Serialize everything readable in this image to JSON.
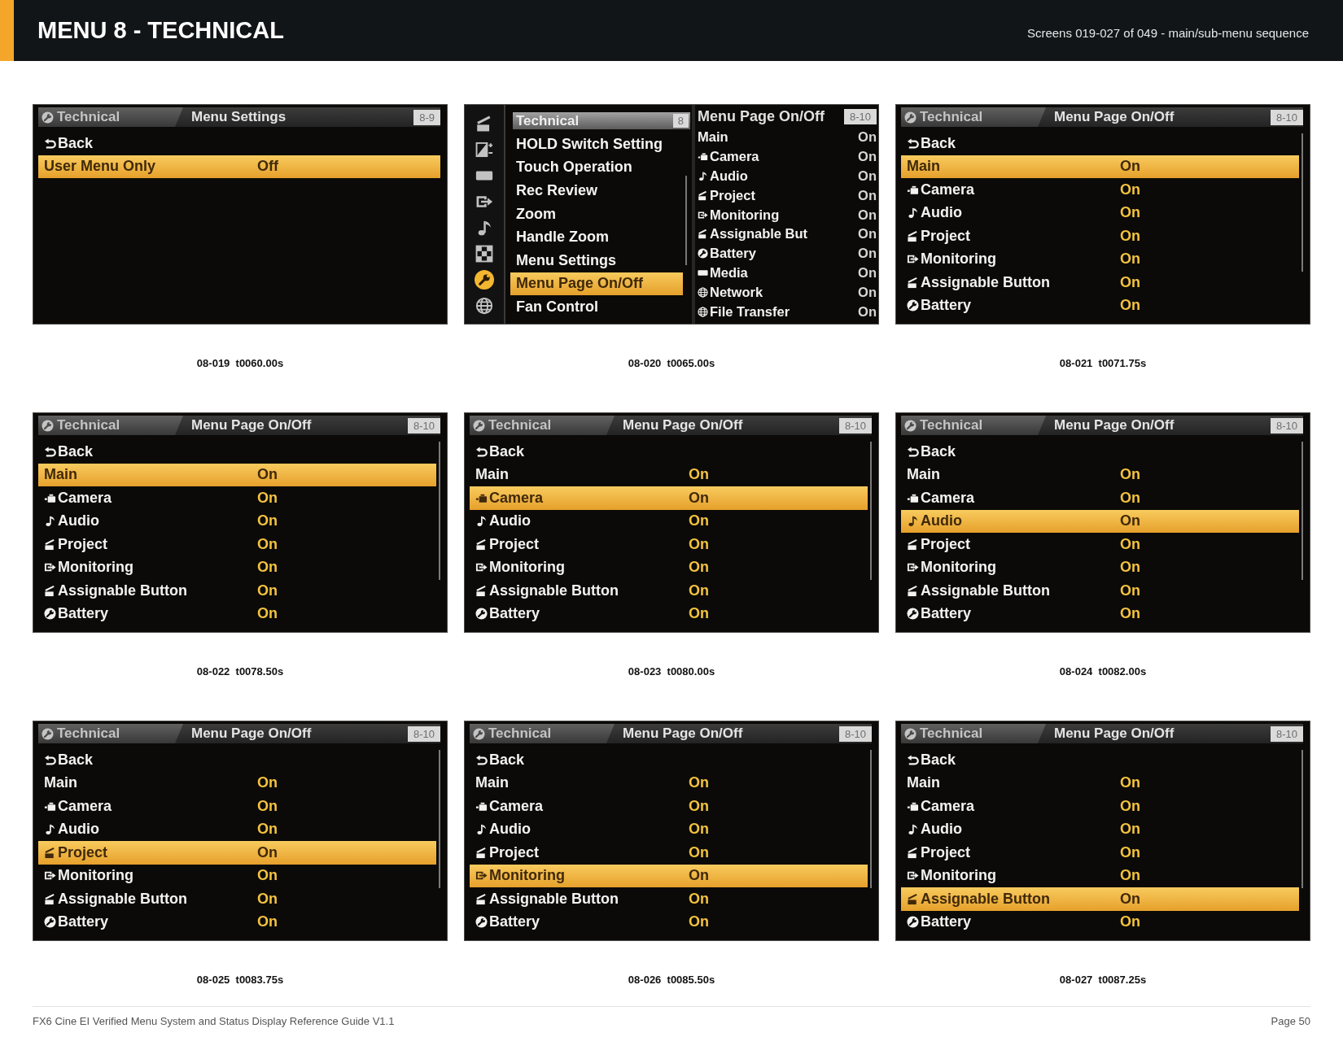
{
  "header": {
    "title": "MENU 8 - TECHNICAL",
    "subtitle": "Screens 019-027 of 049 - main/sub-menu sequence"
  },
  "screens": [
    {
      "kind": "list",
      "breadcrumb": "Technical",
      "title": "Menu Settings",
      "page": "8-9",
      "back": "Back",
      "scrollable": false,
      "rows": [
        {
          "kind": "plain",
          "label": "User Menu Only",
          "value": "Off",
          "selected": true
        }
      ],
      "caption": "08-019  t0060.00s"
    },
    {
      "kind": "split",
      "categories": [
        {
          "kind": "project",
          "selected": false
        },
        {
          "kind": "paint",
          "selected": false
        },
        {
          "kind": "media",
          "selected": false
        },
        {
          "kind": "monitoring",
          "selected": false
        },
        {
          "kind": "audio",
          "selected": false
        },
        {
          "kind": "grid",
          "selected": false
        },
        {
          "kind": "technical",
          "selected": true
        },
        {
          "kind": "network",
          "selected": false
        }
      ],
      "menu": {
        "title": "Technical",
        "page": "8",
        "scrollable": true,
        "items": [
          {
            "label": "HOLD Switch Setting",
            "selected": false
          },
          {
            "label": "Touch Operation",
            "selected": false
          },
          {
            "label": "Rec Review",
            "selected": false
          },
          {
            "label": "Zoom",
            "selected": false
          },
          {
            "label": "Handle Zoom",
            "selected": false
          },
          {
            "label": "Menu Settings",
            "selected": false
          },
          {
            "label": "Menu Page On/Off",
            "selected": true
          },
          {
            "label": "Fan Control",
            "selected": false
          }
        ]
      },
      "submenu": {
        "title": "Menu Page On/Off",
        "page": "8-10",
        "rows": [
          {
            "kind": "plain",
            "label": "Main",
            "value": "On"
          },
          {
            "kind": "camera",
            "label": "Camera",
            "value": "On"
          },
          {
            "kind": "audio",
            "label": "Audio",
            "value": "On"
          },
          {
            "kind": "project",
            "label": "Project",
            "value": "On"
          },
          {
            "kind": "monitoring",
            "label": "Monitoring",
            "value": "On"
          },
          {
            "kind": "assignable",
            "label": "Assignable But",
            "value": "On"
          },
          {
            "kind": "battery",
            "label": "Battery",
            "value": "On"
          },
          {
            "kind": "media",
            "label": "Media",
            "value": "On"
          },
          {
            "kind": "network",
            "label": "Network",
            "value": "On"
          },
          {
            "kind": "transfer",
            "label": "File Transfer",
            "value": "On"
          }
        ]
      },
      "caption": "08-020  t0065.00s"
    },
    {
      "kind": "list",
      "breadcrumb": "Technical",
      "title": "Menu Page On/Off",
      "page": "8-10",
      "back": "Back",
      "scrollable": true,
      "rows": [
        {
          "kind": "plain",
          "label": "Main",
          "value": "On",
          "selected": true
        },
        {
          "kind": "camera",
          "label": "Camera",
          "value": "On",
          "selected": false
        },
        {
          "kind": "audio",
          "label": "Audio",
          "value": "On",
          "selected": false
        },
        {
          "kind": "project",
          "label": "Project",
          "value": "On",
          "selected": false
        },
        {
          "kind": "monitoring",
          "label": "Monitoring",
          "value": "On",
          "selected": false
        },
        {
          "kind": "assignable",
          "label": "Assignable Button",
          "value": "On",
          "selected": false
        },
        {
          "kind": "battery",
          "label": "Battery",
          "value": "On",
          "selected": false
        }
      ],
      "caption": "08-021  t0071.75s"
    },
    {
      "kind": "list",
      "breadcrumb": "Technical",
      "title": "Menu Page On/Off",
      "page": "8-10",
      "back": "Back",
      "scrollable": true,
      "rows": [
        {
          "kind": "plain",
          "label": "Main",
          "value": "On",
          "selected": true
        },
        {
          "kind": "camera",
          "label": "Camera",
          "value": "On",
          "selected": false
        },
        {
          "kind": "audio",
          "label": "Audio",
          "value": "On",
          "selected": false
        },
        {
          "kind": "project",
          "label": "Project",
          "value": "On",
          "selected": false
        },
        {
          "kind": "monitoring",
          "label": "Monitoring",
          "value": "On",
          "selected": false
        },
        {
          "kind": "assignable",
          "label": "Assignable Button",
          "value": "On",
          "selected": false
        },
        {
          "kind": "battery",
          "label": "Battery",
          "value": "On",
          "selected": false
        }
      ],
      "caption": "08-022  t0078.50s"
    },
    {
      "kind": "list",
      "breadcrumb": "Technical",
      "title": "Menu Page On/Off",
      "page": "8-10",
      "back": "Back",
      "scrollable": true,
      "rows": [
        {
          "kind": "plain",
          "label": "Main",
          "value": "On",
          "selected": false
        },
        {
          "kind": "camera",
          "label": "Camera",
          "value": "On",
          "selected": true
        },
        {
          "kind": "audio",
          "label": "Audio",
          "value": "On",
          "selected": false
        },
        {
          "kind": "project",
          "label": "Project",
          "value": "On",
          "selected": false
        },
        {
          "kind": "monitoring",
          "label": "Monitoring",
          "value": "On",
          "selected": false
        },
        {
          "kind": "assignable",
          "label": "Assignable Button",
          "value": "On",
          "selected": false
        },
        {
          "kind": "battery",
          "label": "Battery",
          "value": "On",
          "selected": false
        }
      ],
      "caption": "08-023  t0080.00s"
    },
    {
      "kind": "list",
      "breadcrumb": "Technical",
      "title": "Menu Page On/Off",
      "page": "8-10",
      "back": "Back",
      "scrollable": true,
      "rows": [
        {
          "kind": "plain",
          "label": "Main",
          "value": "On",
          "selected": false
        },
        {
          "kind": "camera",
          "label": "Camera",
          "value": "On",
          "selected": false
        },
        {
          "kind": "audio",
          "label": "Audio",
          "value": "On",
          "selected": true
        },
        {
          "kind": "project",
          "label": "Project",
          "value": "On",
          "selected": false
        },
        {
          "kind": "monitoring",
          "label": "Monitoring",
          "value": "On",
          "selected": false
        },
        {
          "kind": "assignable",
          "label": "Assignable Button",
          "value": "On",
          "selected": false
        },
        {
          "kind": "battery",
          "label": "Battery",
          "value": "On",
          "selected": false
        }
      ],
      "caption": "08-024  t0082.00s"
    },
    {
      "kind": "list",
      "breadcrumb": "Technical",
      "title": "Menu Page On/Off",
      "page": "8-10",
      "back": "Back",
      "scrollable": true,
      "rows": [
        {
          "kind": "plain",
          "label": "Main",
          "value": "On",
          "selected": false
        },
        {
          "kind": "camera",
          "label": "Camera",
          "value": "On",
          "selected": false
        },
        {
          "kind": "audio",
          "label": "Audio",
          "value": "On",
          "selected": false
        },
        {
          "kind": "project",
          "label": "Project",
          "value": "On",
          "selected": true
        },
        {
          "kind": "monitoring",
          "label": "Monitoring",
          "value": "On",
          "selected": false
        },
        {
          "kind": "assignable",
          "label": "Assignable Button",
          "value": "On",
          "selected": false
        },
        {
          "kind": "battery",
          "label": "Battery",
          "value": "On",
          "selected": false
        }
      ],
      "caption": "08-025  t0083.75s"
    },
    {
      "kind": "list",
      "breadcrumb": "Technical",
      "title": "Menu Page On/Off",
      "page": "8-10",
      "back": "Back",
      "scrollable": true,
      "rows": [
        {
          "kind": "plain",
          "label": "Main",
          "value": "On",
          "selected": false
        },
        {
          "kind": "camera",
          "label": "Camera",
          "value": "On",
          "selected": false
        },
        {
          "kind": "audio",
          "label": "Audio",
          "value": "On",
          "selected": false
        },
        {
          "kind": "project",
          "label": "Project",
          "value": "On",
          "selected": false
        },
        {
          "kind": "monitoring",
          "label": "Monitoring",
          "value": "On",
          "selected": true
        },
        {
          "kind": "assignable",
          "label": "Assignable Button",
          "value": "On",
          "selected": false
        },
        {
          "kind": "battery",
          "label": "Battery",
          "value": "On",
          "selected": false
        }
      ],
      "caption": "08-026  t0085.50s"
    },
    {
      "kind": "list",
      "breadcrumb": "Technical",
      "title": "Menu Page On/Off",
      "page": "8-10",
      "back": "Back",
      "scrollable": true,
      "rows": [
        {
          "kind": "plain",
          "label": "Main",
          "value": "On",
          "selected": false
        },
        {
          "kind": "camera",
          "label": "Camera",
          "value": "On",
          "selected": false
        },
        {
          "kind": "audio",
          "label": "Audio",
          "value": "On",
          "selected": false
        },
        {
          "kind": "project",
          "label": "Project",
          "value": "On",
          "selected": false
        },
        {
          "kind": "monitoring",
          "label": "Monitoring",
          "value": "On",
          "selected": false
        },
        {
          "kind": "assignable",
          "label": "Assignable Button",
          "value": "On",
          "selected": true
        },
        {
          "kind": "battery",
          "label": "Battery",
          "value": "On",
          "selected": false
        }
      ],
      "caption": "08-027  t0087.25s"
    }
  ],
  "footer": {
    "document": "FX6 Cine EI Verified Menu System and Status Display Reference Guide V1.1",
    "page": "Page 50"
  }
}
